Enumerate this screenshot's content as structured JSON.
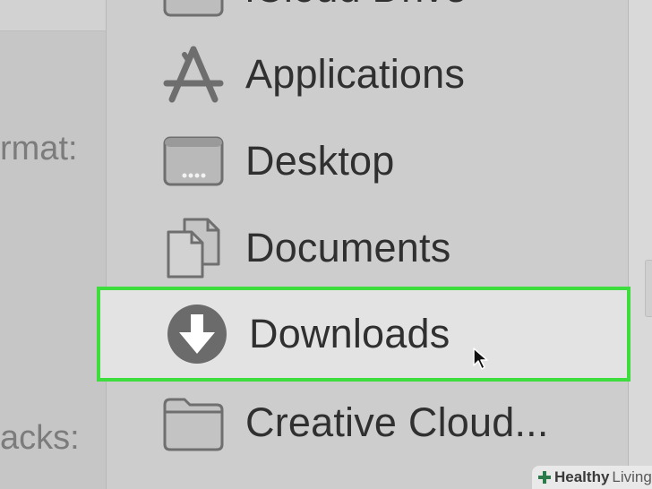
{
  "background": {
    "labels": [
      {
        "id": "format",
        "text": "rmat:"
      },
      {
        "id": "stacks",
        "text": "acks:"
      }
    ]
  },
  "menu": {
    "items": [
      {
        "id": "icloud-drive",
        "label": "iCloud Drive",
        "icon": "cloud-folder-icon",
        "selected": false
      },
      {
        "id": "applications",
        "label": "Applications",
        "icon": "applications-icon",
        "selected": false
      },
      {
        "id": "desktop",
        "label": "Desktop",
        "icon": "desktop-icon",
        "selected": false
      },
      {
        "id": "documents",
        "label": "Documents",
        "icon": "documents-icon",
        "selected": false
      },
      {
        "id": "downloads",
        "label": "Downloads",
        "icon": "download-icon",
        "selected": true
      },
      {
        "id": "creative-cloud",
        "label": "Creative Cloud...",
        "icon": "folder-icon",
        "selected": false
      }
    ]
  },
  "highlight": {
    "color": "#3ddd3d"
  },
  "watermark": {
    "bold": "Healthy",
    "regular": "Living",
    "icon": "medical-cross-icon",
    "color": "#2a7a4a"
  }
}
